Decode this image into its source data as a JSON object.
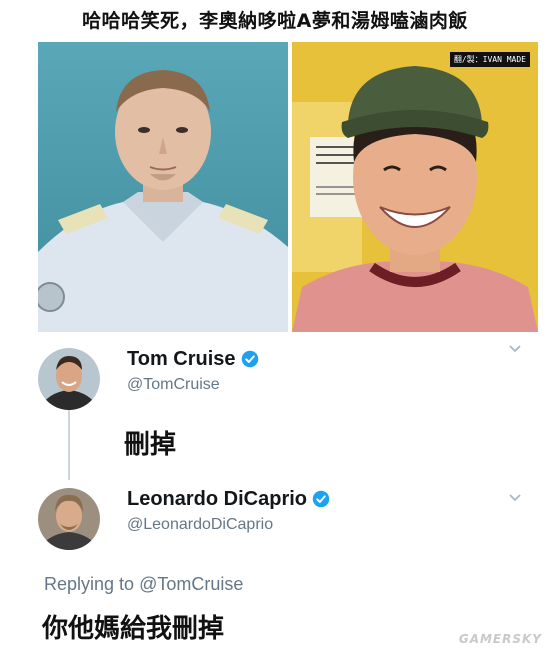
{
  "title": "哈哈哈笑死，李奧納哆啦A夢和湯姆嗑滷肉飯",
  "photo_watermark": "翻/製：IVAN MADE",
  "tweets": [
    {
      "name": "Tom Cruise",
      "handle": "@TomCruise",
      "text": "刪掉"
    },
    {
      "name": "Leonardo DiCaprio",
      "handle": "@LeonardoDiCaprio",
      "replying_prefix": "Replying to",
      "replying_handle": "@TomCruise",
      "text": "你他媽給我刪掉"
    }
  ],
  "site_watermark": "GAMERSKY",
  "colors": {
    "verified": "#1da1f2",
    "handle": "#657786",
    "thread_line": "#ccd6dd"
  },
  "icons": [
    "verified-badge-icon",
    "chevron-down-icon"
  ]
}
